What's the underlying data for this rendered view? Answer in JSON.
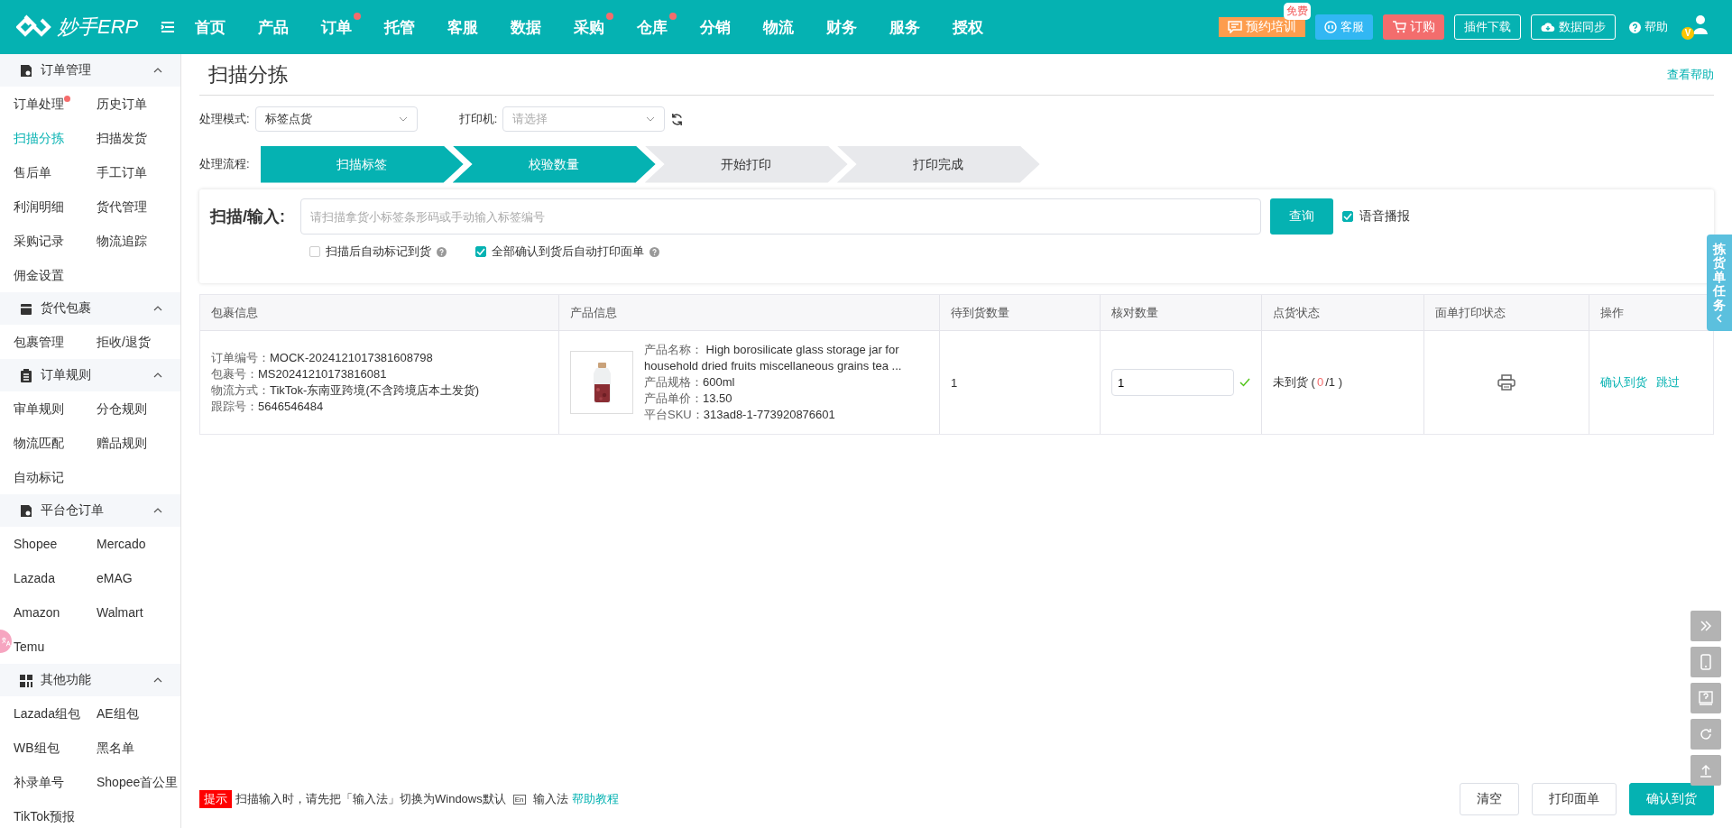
{
  "header": {
    "logo": "妙手ERP",
    "nav": [
      {
        "label": "首页",
        "dot": false
      },
      {
        "label": "产品",
        "dot": false
      },
      {
        "label": "订单",
        "dot": true
      },
      {
        "label": "托管",
        "dot": false
      },
      {
        "label": "客服",
        "dot": false
      },
      {
        "label": "数据",
        "dot": false
      },
      {
        "label": "采购",
        "dot": true
      },
      {
        "label": "仓库",
        "dot": true
      },
      {
        "label": "分销",
        "dot": false
      },
      {
        "label": "物流",
        "dot": false
      },
      {
        "label": "财务",
        "dot": false
      },
      {
        "label": "服务",
        "dot": false
      },
      {
        "label": "授权",
        "dot": false
      }
    ],
    "actions": [
      {
        "kind": "training",
        "label": "预约培训",
        "badge": "免费"
      },
      {
        "kind": "service",
        "label": "客服"
      },
      {
        "kind": "order",
        "label": "订购"
      },
      {
        "kind": "outline",
        "label": "插件下载"
      },
      {
        "kind": "sync",
        "label": "数据同步"
      },
      {
        "kind": "help",
        "label": "帮助"
      }
    ],
    "avatar_badge": "V"
  },
  "sidebar": {
    "sections": [
      {
        "title": "订单管理",
        "expanded": true,
        "items": [
          {
            "label": "订单处理",
            "dot": true,
            "selected": false
          },
          {
            "label": "历史订单",
            "dot": false,
            "selected": false
          },
          {
            "label": "扫描分拣",
            "dot": false,
            "selected": true
          },
          {
            "label": "扫描发货",
            "dot": false,
            "selected": false
          },
          {
            "label": "售后单",
            "dot": false,
            "selected": false
          },
          {
            "label": "手工订单",
            "dot": false,
            "selected": false
          },
          {
            "label": "利润明细",
            "dot": false,
            "selected": false
          },
          {
            "label": "货代管理",
            "dot": false,
            "selected": false
          },
          {
            "label": "采购记录",
            "dot": false,
            "selected": false
          },
          {
            "label": "物流追踪",
            "dot": false,
            "selected": false
          },
          {
            "label": "佣金设置",
            "dot": false,
            "selected": false
          }
        ]
      },
      {
        "title": "货代包裹",
        "expanded": true,
        "items": [
          {
            "label": "包裹管理",
            "dot": false,
            "selected": false
          },
          {
            "label": "拒收/退货",
            "dot": false,
            "selected": false
          }
        ]
      },
      {
        "title": "订单规则",
        "expanded": true,
        "items": [
          {
            "label": "审单规则",
            "dot": false,
            "selected": false
          },
          {
            "label": "分仓规则",
            "dot": false,
            "selected": false
          },
          {
            "label": "物流匹配",
            "dot": false,
            "selected": false
          },
          {
            "label": "赠品规则",
            "dot": false,
            "selected": false
          },
          {
            "label": "自动标记",
            "dot": false,
            "selected": false
          }
        ]
      },
      {
        "title": "平台仓订单",
        "expanded": true,
        "items": [
          {
            "label": "Shopee",
            "dot": false,
            "selected": false
          },
          {
            "label": "Mercado",
            "dot": false,
            "selected": false
          },
          {
            "label": "Lazada",
            "dot": false,
            "selected": false
          },
          {
            "label": "eMAG",
            "dot": false,
            "selected": false
          },
          {
            "label": "Amazon",
            "dot": false,
            "selected": false
          },
          {
            "label": "Walmart",
            "dot": false,
            "selected": false
          },
          {
            "label": "Temu",
            "dot": false,
            "selected": false
          }
        ]
      },
      {
        "title": "其他功能",
        "expanded": true,
        "items": [
          {
            "label": "Lazada组包",
            "dot": false,
            "selected": false
          },
          {
            "label": "AE组包",
            "dot": false,
            "selected": false
          },
          {
            "label": "WB组包",
            "dot": false,
            "selected": false
          },
          {
            "label": "黑名单",
            "dot": false,
            "selected": false
          },
          {
            "label": "补录单号",
            "dot": false,
            "selected": false
          },
          {
            "label": "Shopee首公里",
            "dot": false,
            "selected": false
          },
          {
            "label": "TikTok预报",
            "dot": false,
            "selected": false
          }
        ]
      }
    ]
  },
  "page": {
    "title": "扫描分拣",
    "help_link": "查看帮助",
    "mode": {
      "label": "处理模式:",
      "value": "标签点货"
    },
    "printer": {
      "label": "打印机:",
      "placeholder": "请选择"
    },
    "flow": {
      "label": "处理流程:",
      "steps": [
        {
          "label": "扫描标签",
          "done": true
        },
        {
          "label": "校验数量",
          "done": true
        },
        {
          "label": "开始打印",
          "done": false
        },
        {
          "label": "打印完成",
          "done": false
        }
      ]
    },
    "scan": {
      "label": "扫描/输入:",
      "placeholder": "请扫描拿货小标签条形码或手动输入标签编号",
      "button": "查询",
      "voice": {
        "label": "语音播报",
        "checked": true
      },
      "options": [
        {
          "label": "扫描后自动标记到货",
          "checked": false
        },
        {
          "label": "全部确认到货后自动打印面单",
          "checked": true
        }
      ]
    },
    "table": {
      "columns": [
        "包裹信息",
        "产品信息",
        "待到货数量",
        "核对数量",
        "点货状态",
        "面单打印状态",
        "操作"
      ],
      "rows": [
        {
          "package": [
            {
              "label": "订单编号：",
              "value": "MOCK-2024121017381608798"
            },
            {
              "label": "包裹号：",
              "value": "MS20241210173816081"
            },
            {
              "label": "物流方式：",
              "value": "TikTok-东南亚跨境(不含跨境店本土发货)"
            },
            {
              "label": "跟踪号：",
              "value": "5646546484"
            }
          ],
          "product": [
            {
              "label": "产品名称：",
              "value": " High borosilicate glass storage jar for household dried fruits miscellaneous grains tea ..."
            },
            {
              "label": "产品规格：",
              "value": "600ml"
            },
            {
              "label": "产品单价：",
              "value": "13.50"
            },
            {
              "label": "平台SKU：",
              "value": "313ad8-1-773920876601"
            }
          ],
          "pending": "1",
          "check_qty": "1",
          "verified": true,
          "status": "未到货 (",
          "arrived": "0",
          "status_end": "/1 )",
          "actions": [
            "确认到货",
            "跳过"
          ]
        }
      ]
    }
  },
  "footer": {
    "tip_badge": "提示",
    "tip": "扫描输入时，请先把「输入法」切换为Windows默认",
    "ime_icon": "En",
    "ime": "输入法",
    "help_link": "帮助教程",
    "buttons": [
      {
        "label": "清空",
        "kind": "default"
      },
      {
        "label": "打印面单",
        "kind": "default"
      },
      {
        "label": "确认到货",
        "kind": "primary"
      }
    ]
  },
  "side_tab": "拣货单任务"
}
